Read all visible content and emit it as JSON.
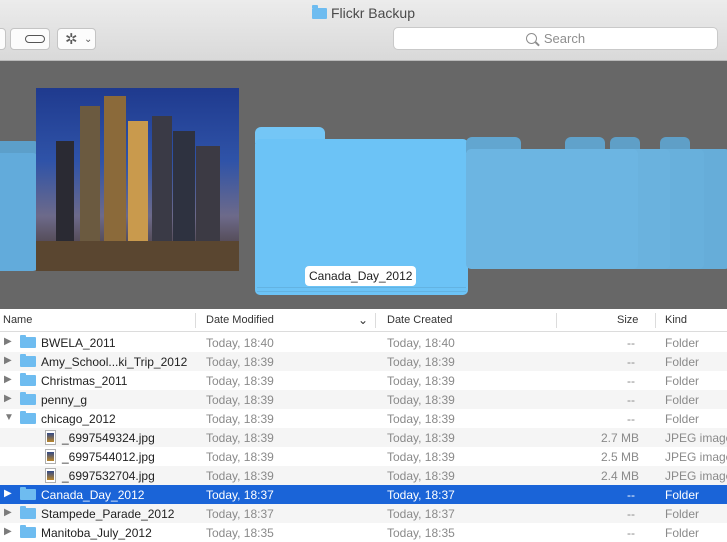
{
  "window": {
    "title": "Flickr Backup"
  },
  "toolbar": {
    "search_placeholder": "Search",
    "gear_glyph": "✲",
    "chevron_glyph": "⌄"
  },
  "cover_flow": {
    "selected_caption": "Canada_Day_2012"
  },
  "columns": {
    "name": "Name",
    "date_modified": "Date Modified",
    "date_created": "Date Created",
    "size": "Size",
    "kind": "Kind",
    "sort_indicator": "⌄"
  },
  "rows": [
    {
      "disclosure": "▶",
      "type": "folder",
      "name": "BWELA_2011",
      "modified": "Today, 18:40",
      "created": "Today, 18:40",
      "size": "--",
      "kind": "Folder"
    },
    {
      "disclosure": "▶",
      "type": "folder",
      "name": "Amy_School...ki_Trip_2012",
      "modified": "Today, 18:39",
      "created": "Today, 18:39",
      "size": "--",
      "kind": "Folder"
    },
    {
      "disclosure": "▶",
      "type": "folder",
      "name": "Christmas_2011",
      "modified": "Today, 18:39",
      "created": "Today, 18:39",
      "size": "--",
      "kind": "Folder"
    },
    {
      "disclosure": "▶",
      "type": "folder",
      "name": "penny_g",
      "modified": "Today, 18:39",
      "created": "Today, 18:39",
      "size": "--",
      "kind": "Folder"
    },
    {
      "disclosure": "▼",
      "type": "folder",
      "name": "chicago_2012",
      "modified": "Today, 18:39",
      "created": "Today, 18:39",
      "size": "--",
      "kind": "Folder"
    },
    {
      "disclosure": "",
      "type": "jpeg",
      "name": "_6997549324.jpg",
      "modified": "Today, 18:39",
      "created": "Today, 18:39",
      "size": "2.7 MB",
      "kind": "JPEG image"
    },
    {
      "disclosure": "",
      "type": "jpeg",
      "name": "_6997544012.jpg",
      "modified": "Today, 18:39",
      "created": "Today, 18:39",
      "size": "2.5 MB",
      "kind": "JPEG image"
    },
    {
      "disclosure": "",
      "type": "jpeg",
      "name": "_6997532704.jpg",
      "modified": "Today, 18:39",
      "created": "Today, 18:39",
      "size": "2.4 MB",
      "kind": "JPEG image"
    },
    {
      "disclosure": "▶",
      "type": "folder",
      "name": "Canada_Day_2012",
      "modified": "Today, 18:37",
      "created": "Today, 18:37",
      "size": "--",
      "kind": "Folder",
      "selected": true
    },
    {
      "disclosure": "▶",
      "type": "folder",
      "name": "Stampede_Parade_2012",
      "modified": "Today, 18:37",
      "created": "Today, 18:37",
      "size": "--",
      "kind": "Folder"
    },
    {
      "disclosure": "▶",
      "type": "folder",
      "name": "Manitoba_July_2012",
      "modified": "Today, 18:35",
      "created": "Today, 18:35",
      "size": "--",
      "kind": "Folder"
    }
  ],
  "colors": {
    "selection": "#1a64d8",
    "folder_blue": "#6ebcf0",
    "coverflow_bg": "#676767"
  }
}
